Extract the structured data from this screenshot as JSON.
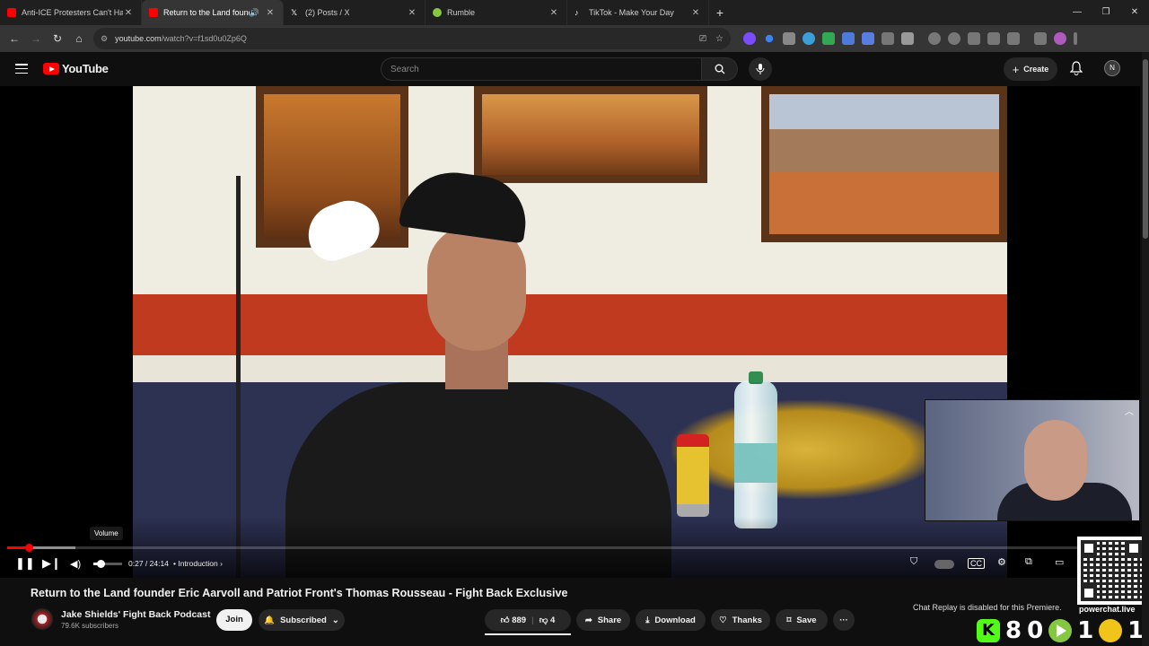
{
  "browser": {
    "tabs": [
      {
        "title": "Anti-ICE Protesters Can't Handl",
        "favicon_color": "#ff0000",
        "active": false
      },
      {
        "title": "Return to the Land founder",
        "favicon_color": "#ff0000",
        "active": true
      },
      {
        "title": "(2) Posts / X",
        "favicon_color": "#ffffff",
        "active": false
      },
      {
        "title": "Rumble",
        "favicon_color": "#85c742",
        "active": false
      },
      {
        "title": "TikTok - Make Your Day",
        "favicon_color": "#ffffff",
        "active": false
      }
    ],
    "url_host": "youtube.com",
    "url_path": "/watch?v=f1sd0u0Zp6Q"
  },
  "youtube": {
    "logo_text": "YouTube",
    "search_placeholder": "Search",
    "create_label": "Create",
    "avatar_initial": "N"
  },
  "player": {
    "volume_tooltip": "Volume",
    "time": "0:27 / 24:14",
    "chapter": "Introduction",
    "progress_fraction": 0.0186,
    "volume_fraction": 0.25
  },
  "video": {
    "title": "Return to the Land founder Eric Aarvoll and Patriot Front's Thomas Rousseau - Fight Back Exclusive",
    "channel_name": "Jake Shields' Fight Back Podcast",
    "subscribers": "79.6K subscribers",
    "join_label": "Join",
    "subscribed_label": "Subscribed",
    "likes": "889",
    "dislikes": "4",
    "share_label": "Share",
    "download_label": "Download",
    "thanks_label": "Thanks",
    "save_label": "Save"
  },
  "overlay": {
    "chat_replay": "Chat Replay is disabled for this Premiere.",
    "powerchat_label": "powerchat.live",
    "kick_count": "8",
    "kick_count2": "0",
    "rumble_count": "1",
    "other_count": "1"
  },
  "colors": {
    "accent": "#ff0000",
    "kick": "#53fc18",
    "rumble": "#85c742"
  }
}
